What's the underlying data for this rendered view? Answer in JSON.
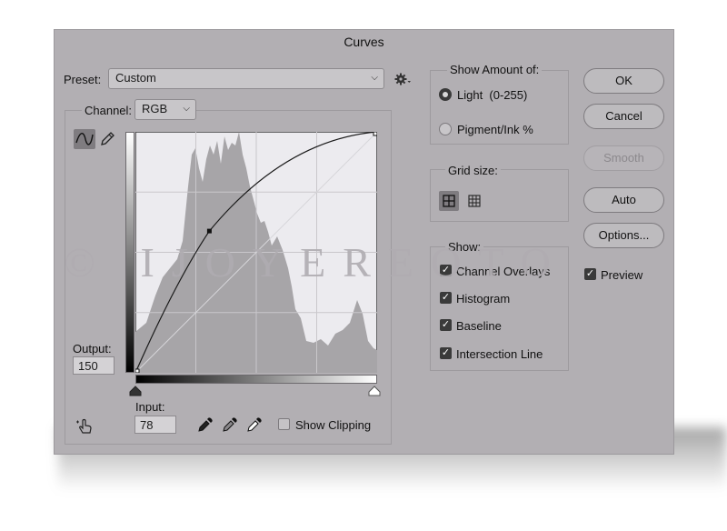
{
  "dialog": {
    "title": "Curves"
  },
  "preset": {
    "label": "Preset:",
    "value": "Custom"
  },
  "channel": {
    "label": "Channel:",
    "value": "RGB"
  },
  "output": {
    "label": "Output:",
    "value": "150"
  },
  "input": {
    "label": "Input:",
    "value": "78"
  },
  "show_clipping": {
    "label": "Show Clipping",
    "checked": false
  },
  "show_amount": {
    "title": "Show Amount of:",
    "options": [
      {
        "label": "Light  (0-255)",
        "selected": true
      },
      {
        "label": "Pigment/Ink %",
        "selected": false
      }
    ]
  },
  "grid_size": {
    "title": "Grid size:",
    "selected": "coarse"
  },
  "show": {
    "title": "Show:",
    "options": [
      {
        "label": "Channel Overlays",
        "checked": true
      },
      {
        "label": "Histogram",
        "checked": true
      },
      {
        "label": "Baseline",
        "checked": true
      },
      {
        "label": "Intersection Line",
        "checked": true
      }
    ]
  },
  "buttons": {
    "ok": "OK",
    "cancel": "Cancel",
    "smooth": "Smooth",
    "auto": "Auto",
    "options": "Options..."
  },
  "preview": {
    "label": "Preview",
    "checked": true
  },
  "watermark": "© IJOYEREOTO",
  "curve": {
    "control_point": {
      "input": 78,
      "output": 150
    }
  },
  "icons": [
    "gear-icon",
    "curve-tool-icon",
    "pencil-icon",
    "hand-adjust-icon",
    "black-eyedropper-icon",
    "gray-eyedropper-icon",
    "white-eyedropper-icon"
  ]
}
